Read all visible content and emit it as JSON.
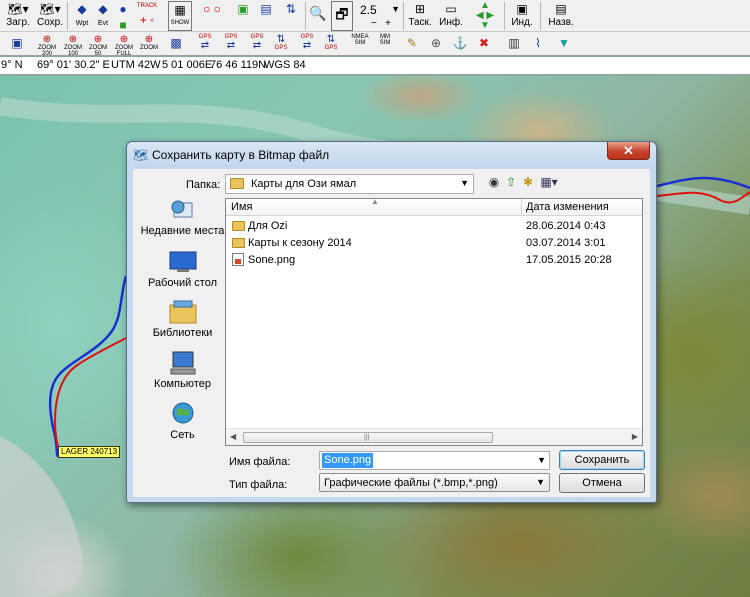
{
  "toolbar1": {
    "load_label": "Загр.",
    "save_label": "Сохр.",
    "wpt_label": "Wpt",
    "evt_label": "Evt",
    "track_label": "TRACK",
    "show_label": "SHOW",
    "zoom_value": "2.5",
    "task_label": "Таск.",
    "info_label": "Инф.",
    "ind_label": "Инд.",
    "name_label": "Назв."
  },
  "toolbar2": {
    "zoom200": "ZOOM 200",
    "zoom100": "ZOOM 100",
    "zoom50": "ZOOM 50",
    "zoom_full": "ZOOM FULL",
    "zoom_plain": "ZOOM",
    "gps_label": "GPS",
    "nmea_label": "NMEA SIM",
    "mm_label": "MM SIM"
  },
  "statusbar": {
    "lat": "9° N",
    "lon": "69° 01' 30.2\" E",
    "utm": "UTM  42W",
    "easting": "5 01 006E",
    "northing": "76 46 119N",
    "datum": "WGS 84"
  },
  "map": {
    "waypoint_label": "LAGER 240713",
    "track_colors": {
      "blue": "#1a2fd0",
      "red": "#e01010"
    }
  },
  "dialog": {
    "title": "Сохранить карту в Bitmap файл",
    "close_symbol": "✕",
    "lookin_label": "Папка:",
    "lookin_value": "Карты для Ози ямал",
    "places": [
      {
        "label": "Недавние места"
      },
      {
        "label": "Рабочий стол"
      },
      {
        "label": "Библиотеки"
      },
      {
        "label": "Компьютер"
      },
      {
        "label": "Сеть"
      }
    ],
    "columns": {
      "name": "Имя",
      "date": "Дата изменения"
    },
    "files": [
      {
        "name": "Для Ozi",
        "date": "28.06.2014 0:43",
        "kind": "folder"
      },
      {
        "name": "Карты к сезону 2014",
        "date": "03.07.2014 3:01",
        "kind": "folder"
      },
      {
        "name": "Sone.png",
        "date": "17.05.2015 20:28",
        "kind": "image"
      }
    ],
    "filename_label": "Имя файла:",
    "filename_value": "Sone.png",
    "filetype_label": "Тип файла:",
    "filetype_value": "Графические файлы (*.bmp,*.png)",
    "save_button": "Сохранить",
    "cancel_button": "Отмена"
  }
}
